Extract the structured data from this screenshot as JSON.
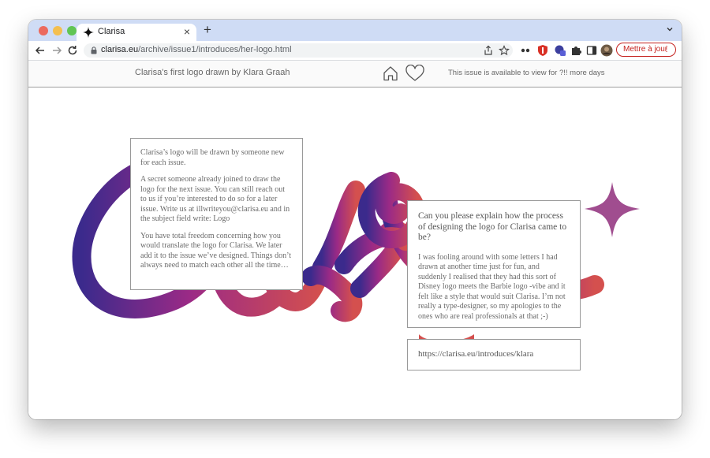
{
  "browser": {
    "tab": {
      "title": "Clarisa"
    },
    "url": {
      "host": "clarisa.eu",
      "path": "/archive/issue1/introduces/her-logo.html"
    },
    "update_button": "Mettre à jour"
  },
  "site": {
    "title": "Clarisa's first logo drawn by Klara Graah",
    "availability": "This issue is available to view for ?!! more days"
  },
  "icons": {
    "tab": "sparkle-icon",
    "home": "home-icon",
    "heart": "heart-icon"
  },
  "colors": {
    "logo_start": "#3b2a8c",
    "logo_mid": "#9b2a86",
    "logo_end": "#d4504e",
    "star": "#a04d8f",
    "update_red": "#c5221f",
    "tabbar": "#cfdcf5"
  },
  "card_intro": {
    "p1": "Clarisa’s logo will be drawn by someone new for each issue.",
    "p2": "A secret someone already joined to draw the logo for the next issue. You can still reach out to us if you’re interested to do so for a later issue. Write us at illwriteyou@clarisa.eu and in the subject field write: Logo",
    "p3": "You have total freedom concerning how you would translate the logo for Clarisa. We later add it to the issue we’ve designed. Things don’t always need to match each other all the time…"
  },
  "card_interview": {
    "question": "Can you please explain how the process of designing the logo for Clarisa came to be?",
    "answer": "I was fooling around with some letters I had drawn at another time just for fun, and suddenly I realised that they had this sort of Disney logo meets the Barbie logo -vibe and it felt like a style that would suit Clarisa. I’m not really a type-designer, so my apologies to the ones who are real professionals at that ;-)"
  },
  "card_link": {
    "url": "https://clarisa.eu/introduces/klara"
  }
}
